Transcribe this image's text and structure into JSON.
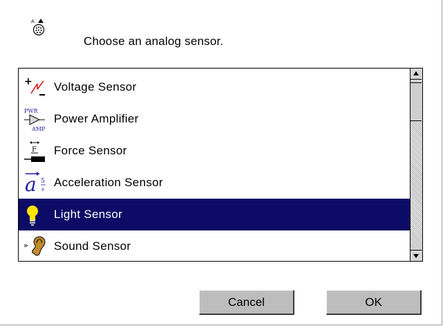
{
  "dialog": {
    "header_icon": "analog-connector-icon",
    "prompt": "Choose an analog sensor."
  },
  "sensors": {
    "selected_index": 4,
    "items": [
      {
        "label": "Voltage Sensor",
        "icon": "voltage-sensor-icon"
      },
      {
        "label": "Power Amplifier",
        "icon": "power-amplifier-icon",
        "icon_text_top": "PWR",
        "icon_text_bottom": "AMP"
      },
      {
        "label": "Force Sensor",
        "icon": "force-sensor-icon",
        "icon_text": "F"
      },
      {
        "label": "Acceleration Sensor",
        "icon": "acceleration-sensor-icon",
        "icon_text": "a",
        "icon_sup": "5"
      },
      {
        "label": "Light Sensor",
        "icon": "light-bulb-icon"
      },
      {
        "label": "Sound Sensor",
        "icon": "ear-icon",
        "icon_text": "»"
      }
    ]
  },
  "buttons": {
    "cancel_label": "Cancel",
    "ok_label": "OK"
  },
  "colors": {
    "selection_bg": "#0c0c66",
    "selection_fg": "#ffffff",
    "button_face": "#bdbdbd",
    "bulb_yellow": "#ffe400"
  }
}
